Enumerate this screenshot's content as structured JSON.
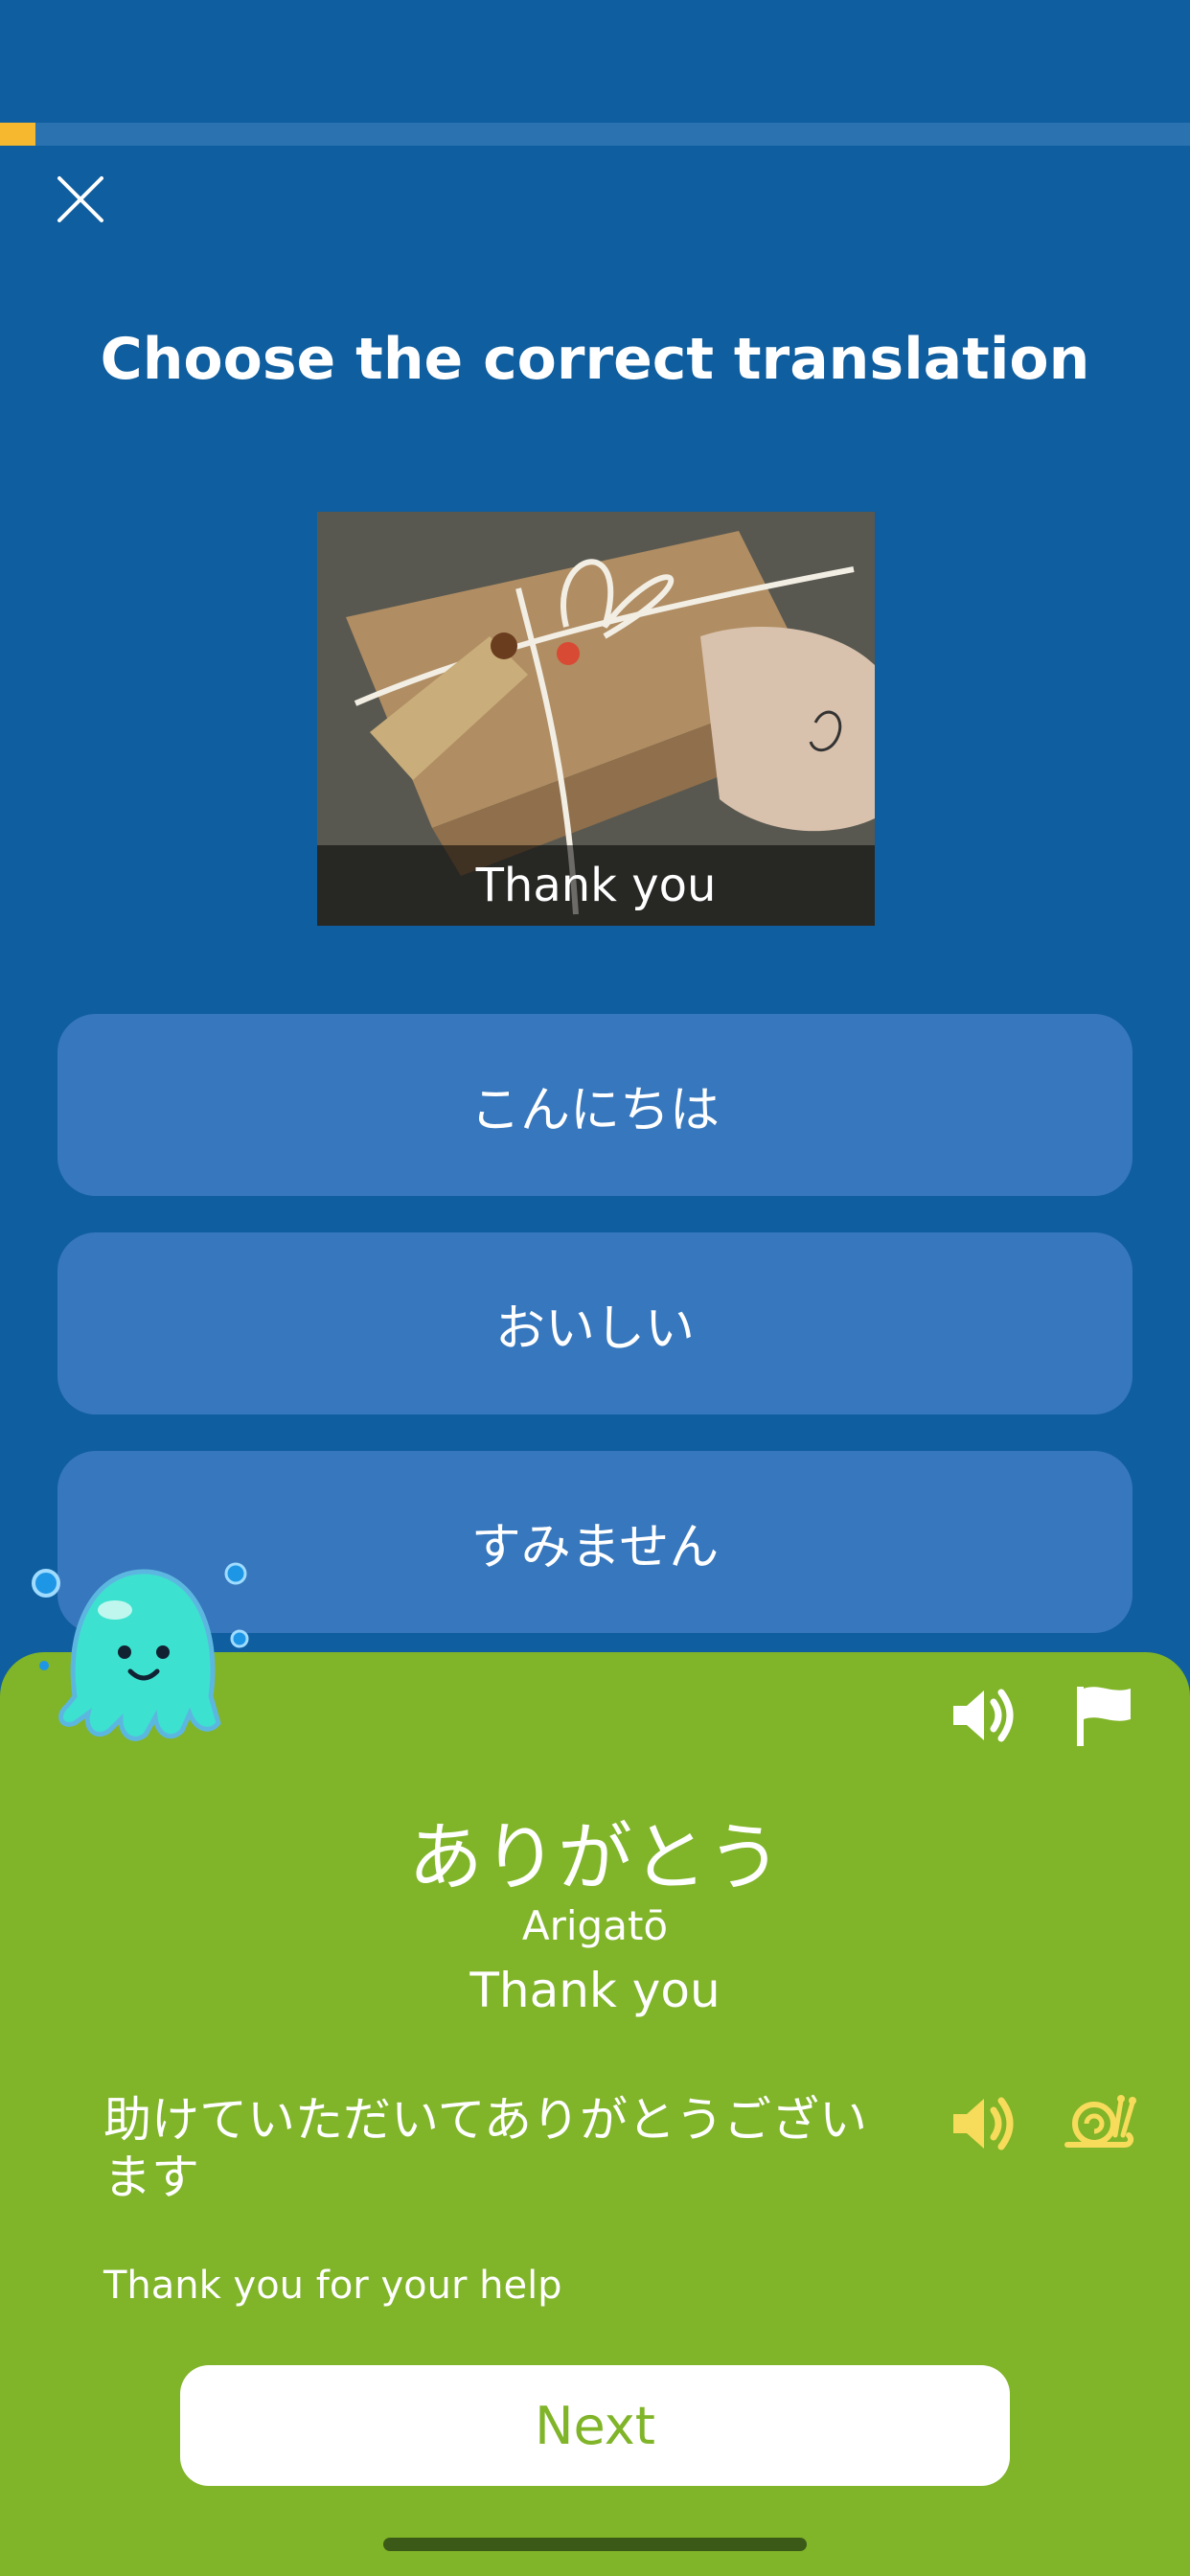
{
  "progress": {
    "fraction": 0.03,
    "color": "#f5b82e"
  },
  "header": {
    "title": "Choose the correct translation"
  },
  "photo": {
    "caption": "Thank you"
  },
  "options": [
    {
      "label": "こんにちは"
    },
    {
      "label": "おいしい"
    },
    {
      "label": "すみません"
    }
  ],
  "feedback": {
    "word_japanese": "ありがとう",
    "word_romaji": "Arigatō",
    "word_english": "Thank you",
    "sentence_japanese": "助けていただいてありがとうございます",
    "sentence_english": "Thank you for your help",
    "next_label": "Next",
    "background": "#80b429"
  },
  "icons": [
    "close-icon",
    "speaker-icon",
    "flag-icon",
    "speaker-icon",
    "snail-icon",
    "octopus-mascot"
  ]
}
